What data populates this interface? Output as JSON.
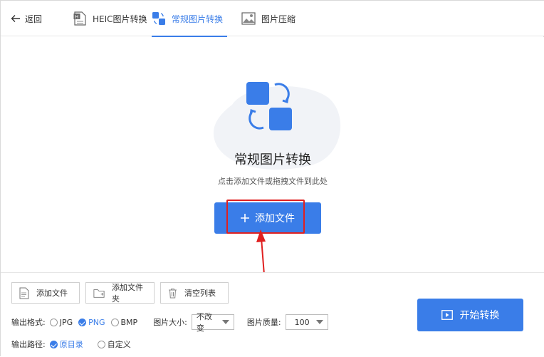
{
  "header": {
    "back_label": "返回",
    "tabs": [
      {
        "label": "HEIC图片转换",
        "icon": "heic-file-icon"
      },
      {
        "label": "常规图片转换",
        "icon": "convert-icon",
        "active": true
      },
      {
        "label": "图片压缩",
        "icon": "image-compress-icon"
      }
    ]
  },
  "main": {
    "title": "常规图片转换",
    "subtitle": "点击添加文件或拖拽文件到此处",
    "add_button": "添加文件"
  },
  "toolbar": {
    "add_file": "添加文件",
    "add_folder": "添加文件夹",
    "clear_list": "清空列表"
  },
  "settings": {
    "format_label": "输出格式:",
    "formats": [
      {
        "label": "JPG",
        "selected": false
      },
      {
        "label": "PNG",
        "selected": true
      },
      {
        "label": "BMP",
        "selected": false
      }
    ],
    "size_label": "图片大小:",
    "size_value": "不改变",
    "quality_label": "图片质量:",
    "quality_value": "100",
    "path_label": "输出路径:",
    "paths": [
      {
        "label": "原目录",
        "selected": true
      },
      {
        "label": "自定义",
        "selected": false
      }
    ]
  },
  "start_button": "开始转换",
  "colors": {
    "accent": "#3a7de8",
    "highlight": "#e02020"
  }
}
